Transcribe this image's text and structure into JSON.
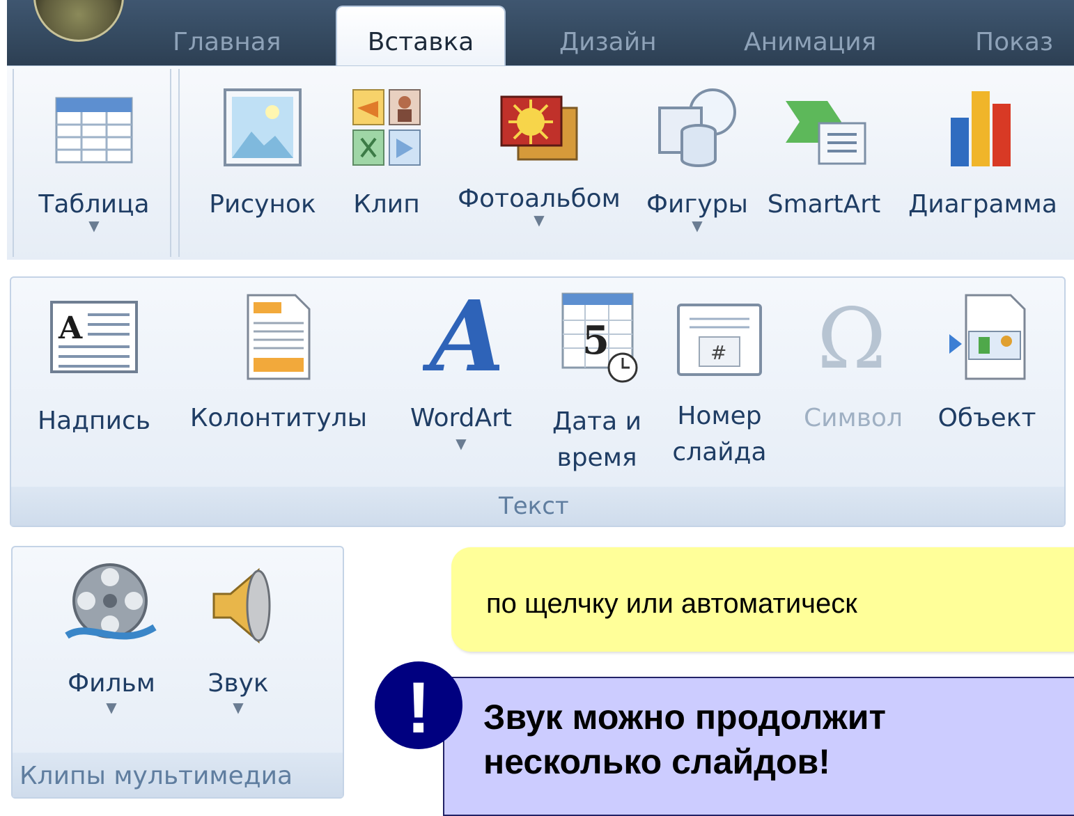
{
  "tabs": [
    {
      "label": "Главная",
      "active": false
    },
    {
      "label": "Вставка",
      "active": true
    },
    {
      "label": "Дизайн",
      "active": false
    },
    {
      "label": "Анимация",
      "active": false
    },
    {
      "label": "Показ",
      "active": false
    }
  ],
  "insert_ribbon": {
    "table": {
      "label": "Таблица",
      "icon": "table-icon",
      "has_dropdown": true
    },
    "picture": {
      "label": "Рисунок",
      "icon": "picture-icon"
    },
    "clip": {
      "label": "Клип",
      "icon": "clipart-icon"
    },
    "photo_album": {
      "label": "Фотоальбом",
      "icon": "photo-album-icon",
      "has_dropdown": true
    },
    "shapes": {
      "label": "Фигуры",
      "icon": "shapes-icon",
      "has_dropdown": true
    },
    "smartart": {
      "label": "SmartArt",
      "icon": "smartart-icon"
    },
    "chart": {
      "label": "Диаграмма",
      "icon": "chart-icon"
    }
  },
  "text_group": {
    "title": "Текст",
    "textbox": {
      "label": "Надпись",
      "icon": "textbox-icon"
    },
    "header_footer": {
      "label": "Колонтитулы",
      "icon": "header-footer-icon"
    },
    "wordart": {
      "label": "WordArt",
      "icon": "wordart-icon",
      "has_dropdown": true
    },
    "date_time": {
      "label_line1": "Дата и",
      "label_line2": "время",
      "icon": "calendar-clock-icon"
    },
    "slide_number": {
      "label_line1": "Номер",
      "label_line2": "слайда",
      "icon": "slide-number-icon"
    },
    "symbol": {
      "label": "Символ",
      "icon": "omega-icon",
      "disabled": true
    },
    "object": {
      "label": "Объект",
      "icon": "object-icon"
    }
  },
  "media_group": {
    "title": "Клипы мультимедиа",
    "movie": {
      "label": "Фильм",
      "icon": "film-reel-icon",
      "has_dropdown": true
    },
    "sound": {
      "label": "Звук",
      "icon": "speaker-icon",
      "has_dropdown": true
    }
  },
  "callout": {
    "text": "по щелчку или автоматическ",
    "color": "#ffff99"
  },
  "note": {
    "mark": "!",
    "line1": "Звук можно продолжит",
    "line2": "несколько слайдов!",
    "box_color": "#ccccff",
    "mark_color": "#000080"
  }
}
